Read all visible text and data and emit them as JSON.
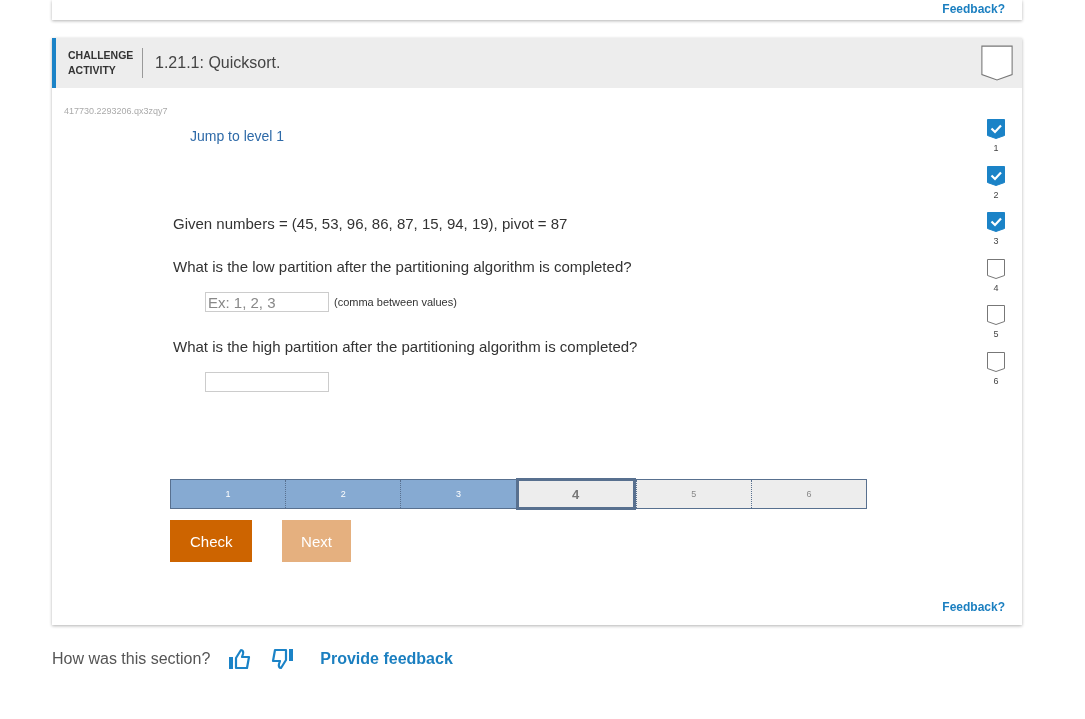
{
  "top_card": {
    "feedback_link": "Feedback?"
  },
  "activity": {
    "type_label": "CHALLENGE ACTIVITY",
    "title": "1.21.1: Quicksort.",
    "completed": false,
    "code": "417730.2293206.qx3zqy7",
    "jump_link": "Jump to level 1",
    "given": "Given numbers = (45, 53, 96, 86, 87, 15, 94, 19), pivot = 87",
    "questions": [
      {
        "prompt": "What is the low partition after the partitioning algorithm is completed?",
        "placeholder": "Ex: 1, 2, 3",
        "hint": "(comma between values)"
      },
      {
        "prompt": "What is the high partition after the partitioning algorithm is completed?"
      }
    ],
    "levels": [
      {
        "label": "1",
        "completed": true,
        "selected": false
      },
      {
        "label": "2",
        "completed": true,
        "selected": false
      },
      {
        "label": "3",
        "completed": true,
        "selected": false
      },
      {
        "label": "4",
        "completed": false,
        "selected": true
      },
      {
        "label": "5",
        "completed": false,
        "selected": false
      },
      {
        "label": "6",
        "completed": false,
        "selected": false
      }
    ],
    "badges": [
      {
        "label": "1",
        "checked": true
      },
      {
        "label": "2",
        "checked": true
      },
      {
        "label": "3",
        "checked": true
      },
      {
        "label": "4",
        "checked": false
      },
      {
        "label": "5",
        "checked": false
      },
      {
        "label": "6",
        "checked": false
      }
    ],
    "buttons": [
      {
        "label": "Check",
        "disabled": false
      },
      {
        "label": "Next",
        "disabled": true
      }
    ],
    "feedback_link": "Feedback?"
  },
  "section_feedback": {
    "question": "How was this section?",
    "link": "Provide feedback"
  }
}
